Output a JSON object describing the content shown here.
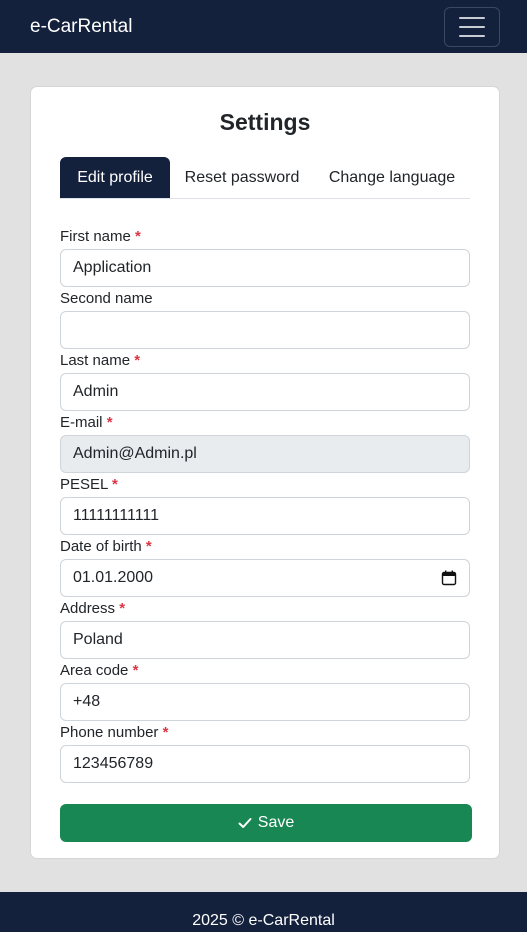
{
  "navbar": {
    "brand": "e-CarRental",
    "toggler_icon": "hamburger-icon"
  },
  "page": {
    "title": "Settings"
  },
  "tabs": [
    {
      "label": "Edit profile",
      "active": true
    },
    {
      "label": "Reset password",
      "active": false
    },
    {
      "label": "Change language",
      "active": false
    }
  ],
  "form": {
    "required_marker": "*",
    "fields": [
      {
        "label": "First name",
        "required": true,
        "value": "Application"
      },
      {
        "label": "Second name",
        "required": false,
        "value": ""
      },
      {
        "label": "Last name",
        "required": true,
        "value": "Admin"
      },
      {
        "label": "E-mail",
        "required": true,
        "value": "Admin@Admin.pl",
        "disabled": true
      },
      {
        "label": "PESEL",
        "required": true,
        "value": "11111111111"
      },
      {
        "label": "Date of birth",
        "required": true,
        "value": "01.01.2000",
        "icon": "calendar-icon"
      },
      {
        "label": "Address",
        "required": true,
        "value": "Poland"
      },
      {
        "label": "Area code",
        "required": true,
        "value": "+48"
      },
      {
        "label": "Phone number",
        "required": true,
        "value": "123456789"
      }
    ],
    "save_label": "Save",
    "save_icon": "check-icon"
  },
  "footer": {
    "text": "2025 © e-CarRental"
  },
  "colors": {
    "navbar": "#14213d",
    "save_button": "#198754",
    "required": "#dc3545",
    "background": "#e1e1e1"
  }
}
